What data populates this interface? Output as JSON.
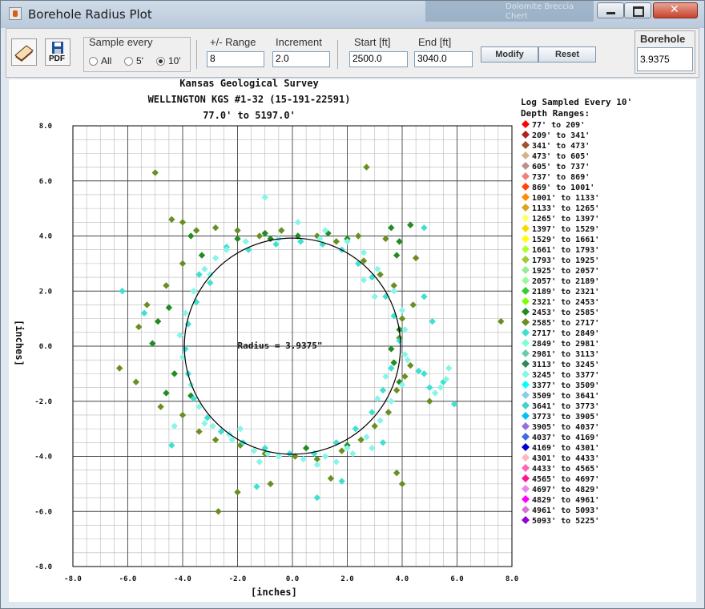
{
  "window": {
    "title": "Borehole Radius Plot",
    "background_text": [
      "Dolomite Breccia",
      "Chert"
    ]
  },
  "toolbar": {
    "sample_every": {
      "label": "Sample every",
      "options": [
        "All",
        "5'",
        "10'"
      ],
      "selected": "10'"
    },
    "range": {
      "label": "+/- Range",
      "value": "8"
    },
    "increment": {
      "label": "Increment",
      "value": "2.0"
    },
    "start": {
      "label": "Start [ft]",
      "value": "2500.0"
    },
    "end": {
      "label": "End [ft]",
      "value": "3040.0"
    },
    "modify_label": "Modify",
    "reset_label": "Reset",
    "borehole": {
      "label": "Borehole",
      "value": "3.9375"
    },
    "pdf_label": "PDF"
  },
  "chart_data": {
    "type": "scatter",
    "title": [
      "Kansas Geological Survey",
      "WELLINGTON KGS #1-32 (15-191-22591)",
      "77.0' to 5197.0'"
    ],
    "xlabel": "[inches]",
    "ylabel": "[inches]",
    "xlim": [
      -8,
      8
    ],
    "ylim": [
      -8,
      8
    ],
    "x_ticks": [
      "-8.0",
      "-6.0",
      "-4.0",
      "-2.0",
      "0.0",
      "2.0",
      "4.0",
      "6.0",
      "8.0"
    ],
    "y_ticks": [
      "8.0",
      "6.0",
      "4.0",
      "2.0",
      "0.0",
      "-2.0",
      "-4.0",
      "-6.0",
      "-8.0"
    ],
    "grid": true,
    "circle_radius": 3.9375,
    "radius_label": "Radius = 3.9375\"",
    "legend": {
      "heading": [
        "Log Sampled Every 10'",
        "Depth Ranges:"
      ],
      "entries": [
        {
          "label": "77' to 209'",
          "color": "#ff0000"
        },
        {
          "label": "209' to 341'",
          "color": "#b22222"
        },
        {
          "label": "341' to 473'",
          "color": "#a0522d"
        },
        {
          "label": "473' to 605'",
          "color": "#d2b48c"
        },
        {
          "label": "605' to 737'",
          "color": "#bc8f8f"
        },
        {
          "label": "737' to 869'",
          "color": "#f08080"
        },
        {
          "label": "869' to 1001'",
          "color": "#ff4500"
        },
        {
          "label": "1001' to 1133'",
          "color": "#ff8c00"
        },
        {
          "label": "1133' to 1265'",
          "color": "#daa520"
        },
        {
          "label": "1265' to 1397'",
          "color": "#ffff66"
        },
        {
          "label": "1397' to 1529'",
          "color": "#ffd700"
        },
        {
          "label": "1529' to 1661'",
          "color": "#ffff00"
        },
        {
          "label": "1661' to 1793'",
          "color": "#adff2f"
        },
        {
          "label": "1793' to 1925'",
          "color": "#9acd32"
        },
        {
          "label": "1925' to 2057'",
          "color": "#90ee90"
        },
        {
          "label": "2057' to 2189'",
          "color": "#98fb98"
        },
        {
          "label": "2189' to 2321'",
          "color": "#32cd32"
        },
        {
          "label": "2321' to 2453'",
          "color": "#7fff00"
        },
        {
          "label": "2453' to 2585'",
          "color": "#228b22"
        },
        {
          "label": "2585' to 2717'",
          "color": "#6b8e23"
        },
        {
          "label": "2717' to 2849'",
          "color": "#40e0d0"
        },
        {
          "label": "2849' to 2981'",
          "color": "#7fffd4"
        },
        {
          "label": "2981' to 3113'",
          "color": "#66cdaa"
        },
        {
          "label": "3113' to 3245'",
          "color": "#2e8b57"
        },
        {
          "label": "3245' to 3377'",
          "color": "#87f5e8"
        },
        {
          "label": "3377' to 3509'",
          "color": "#00ffff"
        },
        {
          "label": "3509' to 3641'",
          "color": "#87ceeb"
        },
        {
          "label": "3641' to 3773'",
          "color": "#48d1cc"
        },
        {
          "label": "3773' to 3905'",
          "color": "#00bfff"
        },
        {
          "label": "3905' to 4037'",
          "color": "#9370db"
        },
        {
          "label": "4037' to 4169'",
          "color": "#4169e1"
        },
        {
          "label": "4169' to 4301'",
          "color": "#0000cd"
        },
        {
          "label": "4301' to 4433'",
          "color": "#ffb6c1"
        },
        {
          "label": "4433' to 4565'",
          "color": "#ff69b4"
        },
        {
          "label": "4565' to 4697'",
          "color": "#ff1493"
        },
        {
          "label": "4697' to 4829'",
          "color": "#ee82ee"
        },
        {
          "label": "4829' to 4961'",
          "color": "#ff00ff"
        },
        {
          "label": "4961' to 5093'",
          "color": "#da70d6"
        },
        {
          "label": "5093' to 5225'",
          "color": "#9400d3"
        }
      ]
    },
    "series": [
      {
        "color": "#6b8e23",
        "points": [
          [
            -5.0,
            6.3
          ],
          [
            2.7,
            6.5
          ],
          [
            -4.4,
            4.6
          ],
          [
            -4.0,
            4.5
          ],
          [
            -3.5,
            4.2
          ],
          [
            -2.8,
            4.3
          ],
          [
            -2.0,
            4.2
          ],
          [
            -1.2,
            4.0
          ],
          [
            -0.4,
            4.2
          ],
          [
            0.9,
            4.0
          ],
          [
            1.6,
            3.8
          ],
          [
            2.4,
            4.0
          ],
          [
            3.4,
            3.9
          ],
          [
            4.5,
            3.2
          ],
          [
            -4.0,
            3.0
          ],
          [
            -4.6,
            2.2
          ],
          [
            -5.3,
            1.5
          ],
          [
            -5.6,
            0.7
          ],
          [
            -6.3,
            -0.8
          ],
          [
            -5.7,
            -1.3
          ],
          [
            -4.8,
            -2.2
          ],
          [
            -4.0,
            -2.5
          ],
          [
            -3.4,
            -3.1
          ],
          [
            -2.8,
            -3.4
          ],
          [
            -1.9,
            -3.6
          ],
          [
            -1.0,
            -3.9
          ],
          [
            0.1,
            -4.0
          ],
          [
            0.9,
            -4.1
          ],
          [
            1.8,
            -3.8
          ],
          [
            2.5,
            -3.4
          ],
          [
            3.0,
            -2.9
          ],
          [
            3.5,
            -2.4
          ],
          [
            3.8,
            -1.6
          ],
          [
            4.1,
            -1.1
          ],
          [
            4.3,
            -0.7
          ],
          [
            3.9,
            0.3
          ],
          [
            4.0,
            1.0
          ],
          [
            4.4,
            1.5
          ],
          [
            3.7,
            2.2
          ],
          [
            3.2,
            2.6
          ],
          [
            2.6,
            3.1
          ],
          [
            7.6,
            0.9
          ],
          [
            -2.0,
            -5.3
          ],
          [
            -2.7,
            -6.0
          ],
          [
            -0.8,
            -5.0
          ],
          [
            1.4,
            -4.8
          ],
          [
            3.8,
            -4.6
          ],
          [
            4.0,
            -5.0
          ],
          [
            5.0,
            -2.0
          ]
        ]
      },
      {
        "color": "#228b22",
        "points": [
          [
            -3.7,
            4.0
          ],
          [
            -2.0,
            3.9
          ],
          [
            -1.0,
            4.1
          ],
          [
            0.2,
            4.0
          ],
          [
            1.3,
            4.1
          ],
          [
            2.0,
            3.9
          ],
          [
            3.6,
            4.3
          ],
          [
            3.9,
            3.8
          ],
          [
            4.3,
            4.4
          ],
          [
            -4.5,
            1.4
          ],
          [
            -4.9,
            0.9
          ],
          [
            -5.1,
            0.1
          ],
          [
            -4.3,
            -1.0
          ],
          [
            -3.7,
            -1.8
          ],
          [
            3.6,
            -0.1
          ],
          [
            3.7,
            -0.6
          ],
          [
            3.9,
            -1.3
          ],
          [
            0.5,
            -3.7
          ],
          [
            2.0,
            -3.6
          ],
          [
            3.8,
            3.3
          ],
          [
            -0.8,
            3.9
          ],
          [
            -3.3,
            3.3
          ],
          [
            3.9,
            0.6
          ],
          [
            -4.6,
            -1.7
          ]
        ]
      },
      {
        "color": "#40e0d0",
        "points": [
          [
            -6.2,
            2.0
          ],
          [
            -3.4,
            2.6
          ],
          [
            -2.4,
            3.6
          ],
          [
            -1.6,
            3.5
          ],
          [
            -0.6,
            3.7
          ],
          [
            0.3,
            3.8
          ],
          [
            1.1,
            3.7
          ],
          [
            1.8,
            3.5
          ],
          [
            2.4,
            3.0
          ],
          [
            2.9,
            2.5
          ],
          [
            3.4,
            1.8
          ],
          [
            3.7,
            1.1
          ],
          [
            3.9,
            0.2
          ],
          [
            3.6,
            -0.8
          ],
          [
            3.3,
            -1.6
          ],
          [
            2.9,
            -2.4
          ],
          [
            2.3,
            -3.0
          ],
          [
            1.6,
            -3.5
          ],
          [
            0.8,
            -3.9
          ],
          [
            -0.1,
            -3.9
          ],
          [
            -1.0,
            -3.7
          ],
          [
            -1.8,
            -3.5
          ],
          [
            -2.6,
            -3.1
          ],
          [
            -3.1,
            -2.6
          ],
          [
            -3.6,
            -1.9
          ],
          [
            -3.8,
            -1.0
          ],
          [
            -3.9,
            -0.1
          ],
          [
            -3.8,
            0.8
          ],
          [
            -3.5,
            1.6
          ],
          [
            -3.0,
            2.3
          ],
          [
            -5.4,
            1.2
          ],
          [
            -4.4,
            -3.6
          ],
          [
            4.8,
            -1.0
          ],
          [
            5.0,
            -1.5
          ],
          [
            5.5,
            -1.3
          ],
          [
            5.9,
            -2.1
          ],
          [
            4.6,
            -0.9
          ],
          [
            1.8,
            -4.9
          ],
          [
            0.9,
            -5.5
          ],
          [
            -1.3,
            -5.1
          ],
          [
            3.3,
            -3.5
          ],
          [
            5.1,
            0.9
          ],
          [
            4.8,
            1.8
          ],
          [
            4.8,
            4.3
          ]
        ]
      },
      {
        "color": "#87f5e8",
        "points": [
          [
            -1.0,
            5.4
          ],
          [
            -2.8,
            3.2
          ],
          [
            1.2,
            4.2
          ],
          [
            0.2,
            4.5
          ],
          [
            -3.2,
            2.8
          ],
          [
            -3.6,
            2.0
          ],
          [
            -3.9,
            1.2
          ],
          [
            -4.1,
            0.4
          ],
          [
            -4.0,
            -0.4
          ],
          [
            -3.7,
            -1.4
          ],
          [
            -3.4,
            -2.2
          ],
          [
            -2.9,
            -2.9
          ],
          [
            -2.2,
            -3.4
          ],
          [
            -1.4,
            -3.8
          ],
          [
            -0.5,
            -4.0
          ],
          [
            0.4,
            -4.1
          ],
          [
            1.2,
            -4.0
          ],
          [
            2.0,
            -3.7
          ],
          [
            2.7,
            -3.3
          ],
          [
            3.2,
            -2.7
          ],
          [
            3.6,
            -2.0
          ],
          [
            4.0,
            -1.4
          ],
          [
            4.2,
            -0.5
          ],
          [
            4.1,
            0.6
          ],
          [
            4.0,
            1.3
          ],
          [
            3.7,
            2.0
          ],
          [
            3.1,
            2.8
          ],
          [
            2.6,
            3.4
          ],
          [
            2.0,
            3.8
          ],
          [
            1.0,
            3.9
          ],
          [
            -0.5,
            3.9
          ],
          [
            -1.7,
            3.8
          ],
          [
            -2.4,
            3.5
          ],
          [
            -3.0,
            2.6
          ],
          [
            3.0,
            1.8
          ],
          [
            2.6,
            2.4
          ],
          [
            3.4,
            -1.1
          ],
          [
            3.1,
            -1.9
          ],
          [
            5.2,
            -1.7
          ],
          [
            5.4,
            -1.5
          ],
          [
            5.6,
            -1.2
          ],
          [
            5.7,
            -0.8
          ],
          [
            -4.3,
            -2.9
          ],
          [
            -3.2,
            -2.8
          ],
          [
            -2.3,
            -3.2
          ],
          [
            -1.9,
            -3.0
          ],
          [
            -0.9,
            -3.9
          ],
          [
            -1.2,
            -4.2
          ],
          [
            0.9,
            -4.3
          ],
          [
            1.6,
            -4.2
          ],
          [
            2.2,
            -3.9
          ],
          [
            2.9,
            -3.7
          ],
          [
            4.1,
            -0.3
          ]
        ]
      }
    ]
  }
}
